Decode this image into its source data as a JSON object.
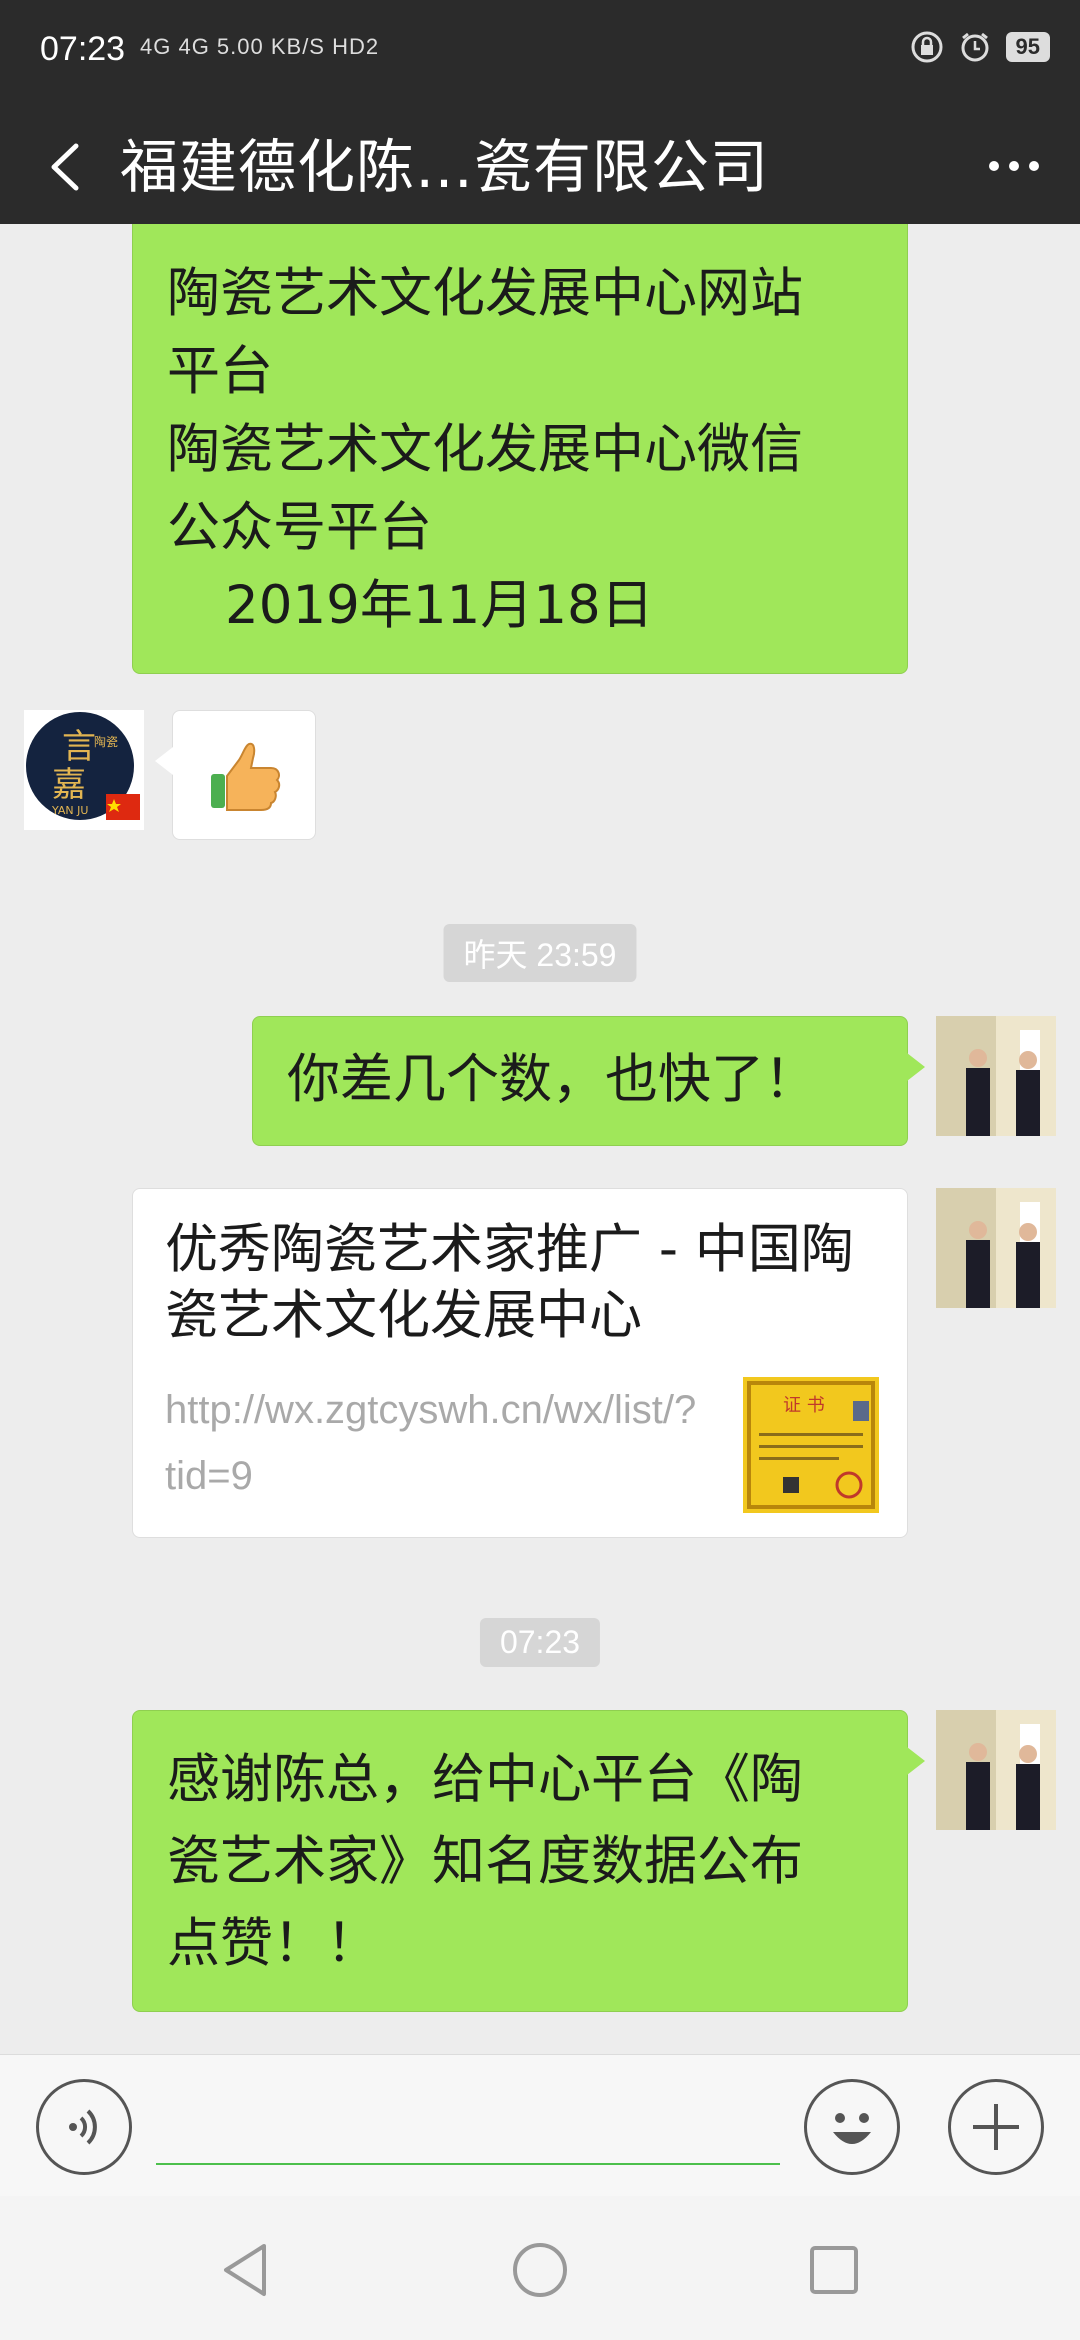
{
  "status_bar": {
    "time": "07:23",
    "network": "4G 4G 5.00 KB/S HD2",
    "battery": "95"
  },
  "header": {
    "title": "福建德化陈…瓷有限公司"
  },
  "messages": [
    {
      "id": "msg1",
      "side": "right",
      "lines": [
        "陶瓷艺术文化发展中心网站",
        "平台",
        "陶瓷艺术文化发展中心微信",
        "公众号平台"
      ],
      "date_line": "2019年11月18日"
    },
    {
      "id": "msg2",
      "side": "left",
      "type": "emoji",
      "emoji": "👍",
      "avatar_text": "言嘉",
      "avatar_small": "陶瓷",
      "avatar_caption": "YAN JU"
    },
    {
      "id": "ts1",
      "type": "timestamp",
      "text": "昨天 23:59"
    },
    {
      "id": "msg3",
      "side": "right",
      "text": "你差几个数，也快了！"
    },
    {
      "id": "msg4",
      "side": "right",
      "type": "link",
      "title": "优秀陶瓷艺术家推广 - 中国陶瓷艺术文化发展中心",
      "url": "http://wx.zgtcyswh.cn/wx/list/?tid=9",
      "thumb_text": "证 书"
    },
    {
      "id": "ts2",
      "type": "timestamp",
      "text": "07:23"
    },
    {
      "id": "msg5",
      "side": "right",
      "lines": [
        "感谢陈总，给中心平台《陶",
        "瓷艺术家》知名度数据公布",
        "点赞！！"
      ]
    }
  ],
  "input": {
    "value": ""
  },
  "icons": {
    "back": "back-icon",
    "more": "more-icon",
    "voice": "voice-icon",
    "emoji": "emoji-icon",
    "plus": "plus-icon"
  },
  "colors": {
    "bubble_green": "#a0e75a",
    "header_bg": "#2b2b2b",
    "chat_bg": "#ededed"
  }
}
